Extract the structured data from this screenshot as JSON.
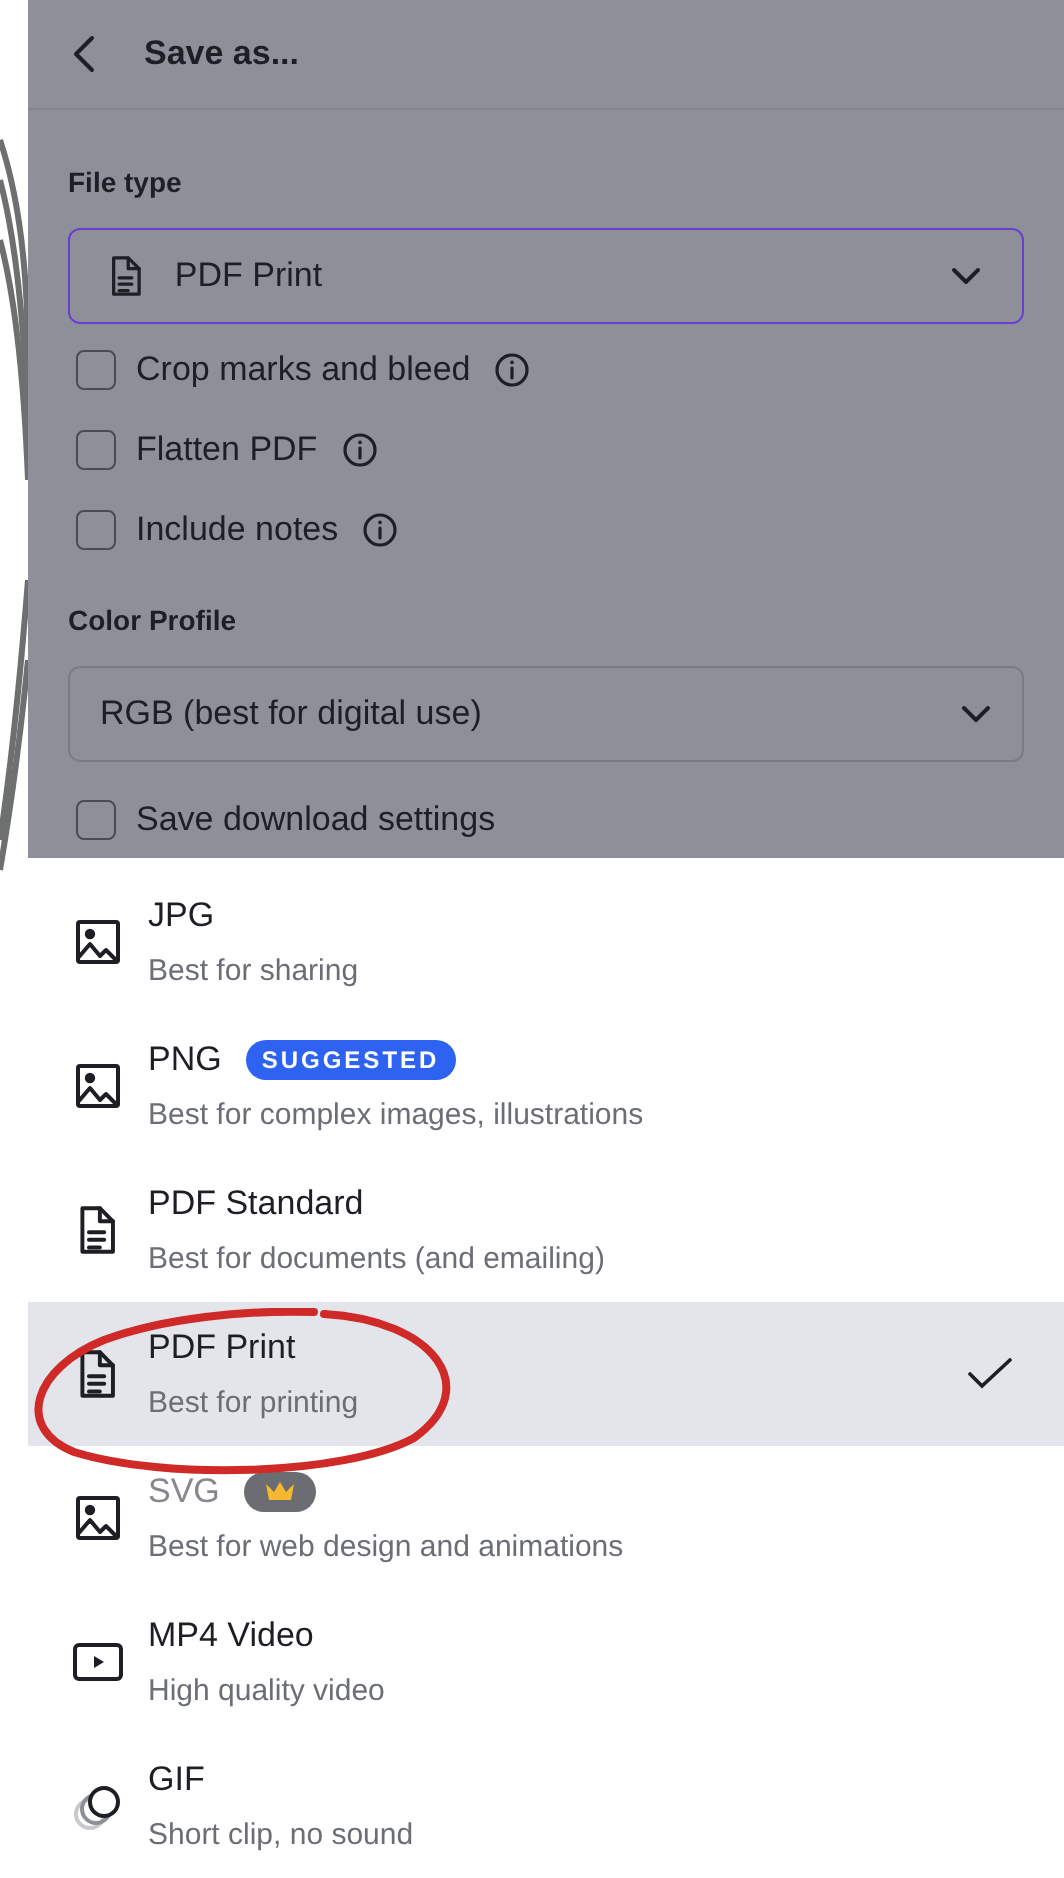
{
  "header": {
    "title": "Save as..."
  },
  "file_type": {
    "label": "File type",
    "value": "PDF Print",
    "focused": true
  },
  "options": [
    {
      "label": "Crop marks and bleed",
      "checked": false,
      "info": true
    },
    {
      "label": "Flatten PDF",
      "checked": false,
      "info": true
    },
    {
      "label": "Include notes",
      "checked": false,
      "info": true
    }
  ],
  "color_profile": {
    "label": "Color Profile",
    "value": "RGB (best for digital use)"
  },
  "save_settings": {
    "label": "Save download settings",
    "checked": false
  },
  "formats": [
    {
      "kind": "image",
      "title": "JPG",
      "subtitle": "Best for sharing",
      "selected": false,
      "disabled": false
    },
    {
      "kind": "image",
      "title": "PNG",
      "badge": {
        "kind": "text",
        "text": "SUGGESTED"
      },
      "subtitle": "Best for complex images, illustrations",
      "selected": false,
      "disabled": false
    },
    {
      "kind": "document",
      "title": "PDF Standard",
      "subtitle": "Best for documents (and emailing)",
      "selected": false,
      "disabled": false
    },
    {
      "kind": "document",
      "title": "PDF Print",
      "subtitle": "Best for printing",
      "selected": true,
      "disabled": false
    },
    {
      "kind": "image",
      "title": "SVG",
      "badge": {
        "kind": "crown"
      },
      "subtitle": "Best for web design and animations",
      "selected": false,
      "disabled": true
    },
    {
      "kind": "video",
      "title": "MP4 Video",
      "subtitle": "High quality video",
      "selected": false,
      "disabled": false
    },
    {
      "kind": "gif",
      "title": "GIF",
      "subtitle": "Short clip, no sound",
      "selected": false,
      "disabled": false
    }
  ]
}
